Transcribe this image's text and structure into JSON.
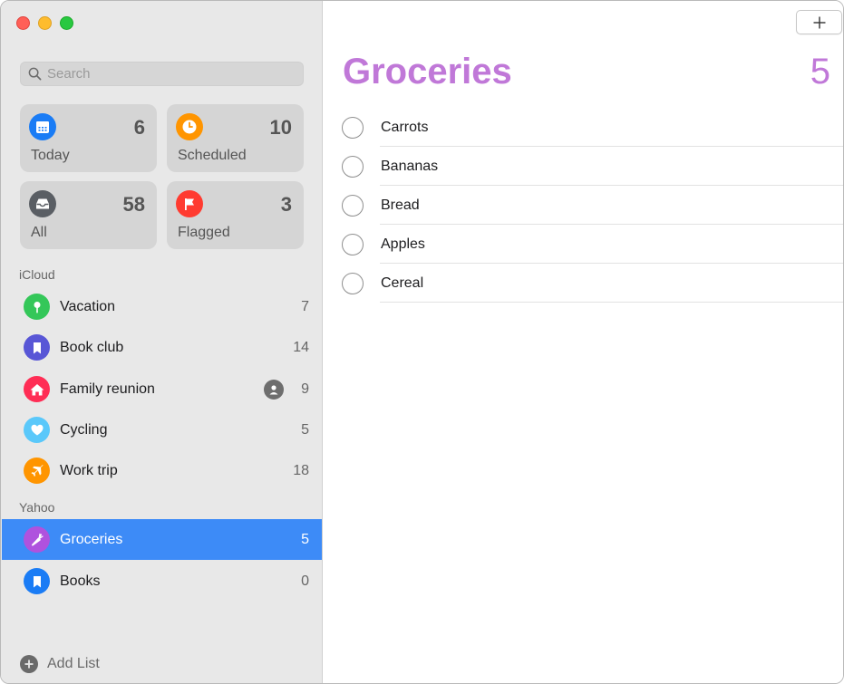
{
  "window": {
    "controls": [
      "close",
      "minimize",
      "zoom"
    ]
  },
  "search": {
    "placeholder": "Search",
    "value": ""
  },
  "smart_lists": [
    {
      "label": "Today",
      "count": "6",
      "icon": "calendar-icon",
      "color": "#1a7cf5"
    },
    {
      "label": "Scheduled",
      "count": "10",
      "icon": "clock-icon",
      "color": "#ff9500"
    },
    {
      "label": "All",
      "count": "58",
      "icon": "tray-icon",
      "color": "#5a5e64"
    },
    {
      "label": "Flagged",
      "count": "3",
      "icon": "flag-icon",
      "color": "#ff3b30"
    }
  ],
  "sections": {
    "icloud": "iCloud",
    "yahoo": "Yahoo"
  },
  "icloud_lists": [
    {
      "name": "Vacation",
      "count": "7",
      "icon": "pin-icon",
      "color": "#34c759"
    },
    {
      "name": "Book club",
      "count": "14",
      "icon": "bookmark-icon",
      "color": "#5856d6"
    },
    {
      "name": "Family reunion",
      "count": "9",
      "icon": "house-icon",
      "color": "#ff2d55",
      "shared": true
    },
    {
      "name": "Cycling",
      "count": "5",
      "icon": "heart-icon",
      "color": "#5ac8fa"
    },
    {
      "name": "Work trip",
      "count": "18",
      "icon": "airplane-icon",
      "color": "#ff9500"
    }
  ],
  "yahoo_lists": [
    {
      "name": "Groceries",
      "count": "5",
      "icon": "carrot-icon",
      "color": "#af52de",
      "selected": true
    },
    {
      "name": "Books",
      "count": "0",
      "icon": "bookmark-icon",
      "color": "#1a7cf5"
    }
  ],
  "add_list_label": "Add List",
  "main": {
    "title": "Groceries",
    "count": "5",
    "accent": "#c078d8",
    "add_button": "+",
    "items": [
      "Carrots",
      "Bananas",
      "Bread",
      "Apples",
      "Cereal"
    ]
  }
}
